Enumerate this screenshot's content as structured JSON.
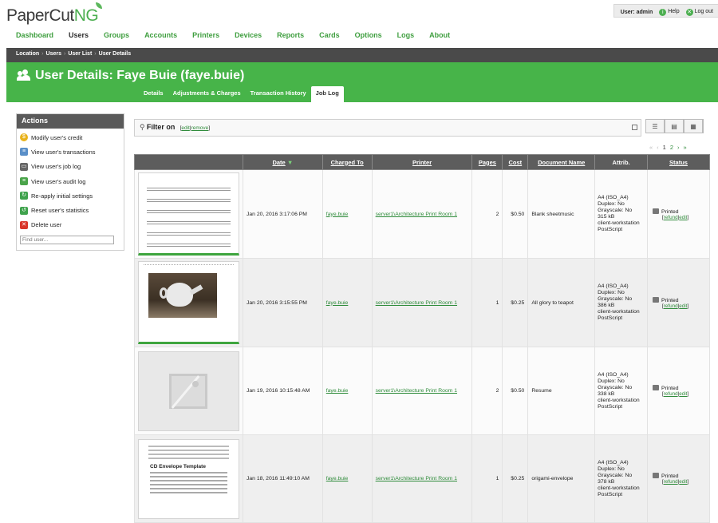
{
  "app": {
    "logo_main": "PaperCut",
    "logo_suffix": "NG"
  },
  "userbox": {
    "user_label": "User: admin",
    "help": "Help",
    "logout": "Log out"
  },
  "nav": [
    "Dashboard",
    "Users",
    "Groups",
    "Accounts",
    "Printers",
    "Devices",
    "Reports",
    "Cards",
    "Options",
    "Logs",
    "About"
  ],
  "nav_active": "Users",
  "breadcrumb": [
    "Location",
    "Users",
    "User List",
    "User Details"
  ],
  "page_title": "User Details: Faye Buie (faye.buie)",
  "tabs": [
    "Details",
    "Adjustments & Charges",
    "Transaction History",
    "Job Log"
  ],
  "tab_selected": "Job Log",
  "actions": {
    "title": "Actions",
    "items": [
      {
        "label": "Modify user's credit",
        "icon": "coin-icon"
      },
      {
        "label": "View user's transactions",
        "icon": "transactions-icon"
      },
      {
        "label": "View user's job log",
        "icon": "printer-icon"
      },
      {
        "label": "View user's audit log",
        "icon": "list-icon"
      },
      {
        "label": "Re-apply initial settings",
        "icon": "reapply-icon"
      },
      {
        "label": "Reset user's statistics",
        "icon": "reset-icon"
      },
      {
        "label": "Delete user",
        "icon": "delete-icon"
      }
    ],
    "find_placeholder": "Find user..."
  },
  "filter": {
    "label": "Filter on",
    "edit": "edit",
    "remove": "remove"
  },
  "pager": {
    "pages": [
      "1",
      "2"
    ],
    "current": "1"
  },
  "table": {
    "headers": [
      "Date",
      "Charged To",
      "Printer",
      "Pages",
      "Cost",
      "Document Name",
      "Attrib.",
      "Status"
    ],
    "rows": [
      {
        "date": "Jan 20, 2016 3:17:06 PM",
        "charged_to": "faye.buie",
        "printer": "server1\\Architecture Print Room 1",
        "pages": "2",
        "cost": "$0.50",
        "document": "Blank sheetmusic",
        "attrib": [
          "A4 (ISO_A4)",
          "Duplex: No",
          "Grayscale: No",
          "315 kB",
          "client-workstation",
          "PostScript"
        ],
        "status": "Printed",
        "refund": "refund",
        "edit": "edit",
        "thumb": "sheetmusic"
      },
      {
        "date": "Jan 20, 2016 3:15:55 PM",
        "charged_to": "faye.buie",
        "printer": "server1\\Architecture Print Room 1",
        "pages": "1",
        "cost": "$0.25",
        "document": "All glory to teapot",
        "attrib": [
          "A4 (ISO_A4)",
          "Duplex: No",
          "Grayscale: No",
          "386 kB",
          "client-workstation",
          "PostScript"
        ],
        "status": "Printed",
        "refund": "refund",
        "edit": "edit",
        "thumb": "teapot"
      },
      {
        "date": "Jan 19, 2016 10:15:48 AM",
        "charged_to": "faye.buie",
        "printer": "server1\\Architecture Print Room 1",
        "pages": "2",
        "cost": "$0.50",
        "document": "Resume",
        "attrib": [
          "A4 (ISO_A4)",
          "Duplex: No",
          "Grayscale: No",
          "338 kB",
          "client-workstation",
          "PostScript"
        ],
        "status": "Printed",
        "refund": "refund",
        "edit": "edit",
        "thumb": "placeholder"
      },
      {
        "date": "Jan 18, 2016 11:49:10 AM",
        "charged_to": "faye.buie",
        "printer": "server1\\Architecture Print Room 1",
        "pages": "1",
        "cost": "$0.25",
        "document": "origami-envelope",
        "attrib": [
          "A4 (ISO_A4)",
          "Duplex: No",
          "Grayscale: No",
          "378 kB",
          "client-workstation",
          "PostScript"
        ],
        "status": "Printed",
        "refund": "refund",
        "edit": "edit",
        "thumb": "envelope",
        "thumb_title": "CD Envelope Template"
      }
    ]
  },
  "colors": {
    "brand_green": "#47b449",
    "link_green": "#2e8b3a",
    "dark_bar": "#4a4a4a"
  }
}
